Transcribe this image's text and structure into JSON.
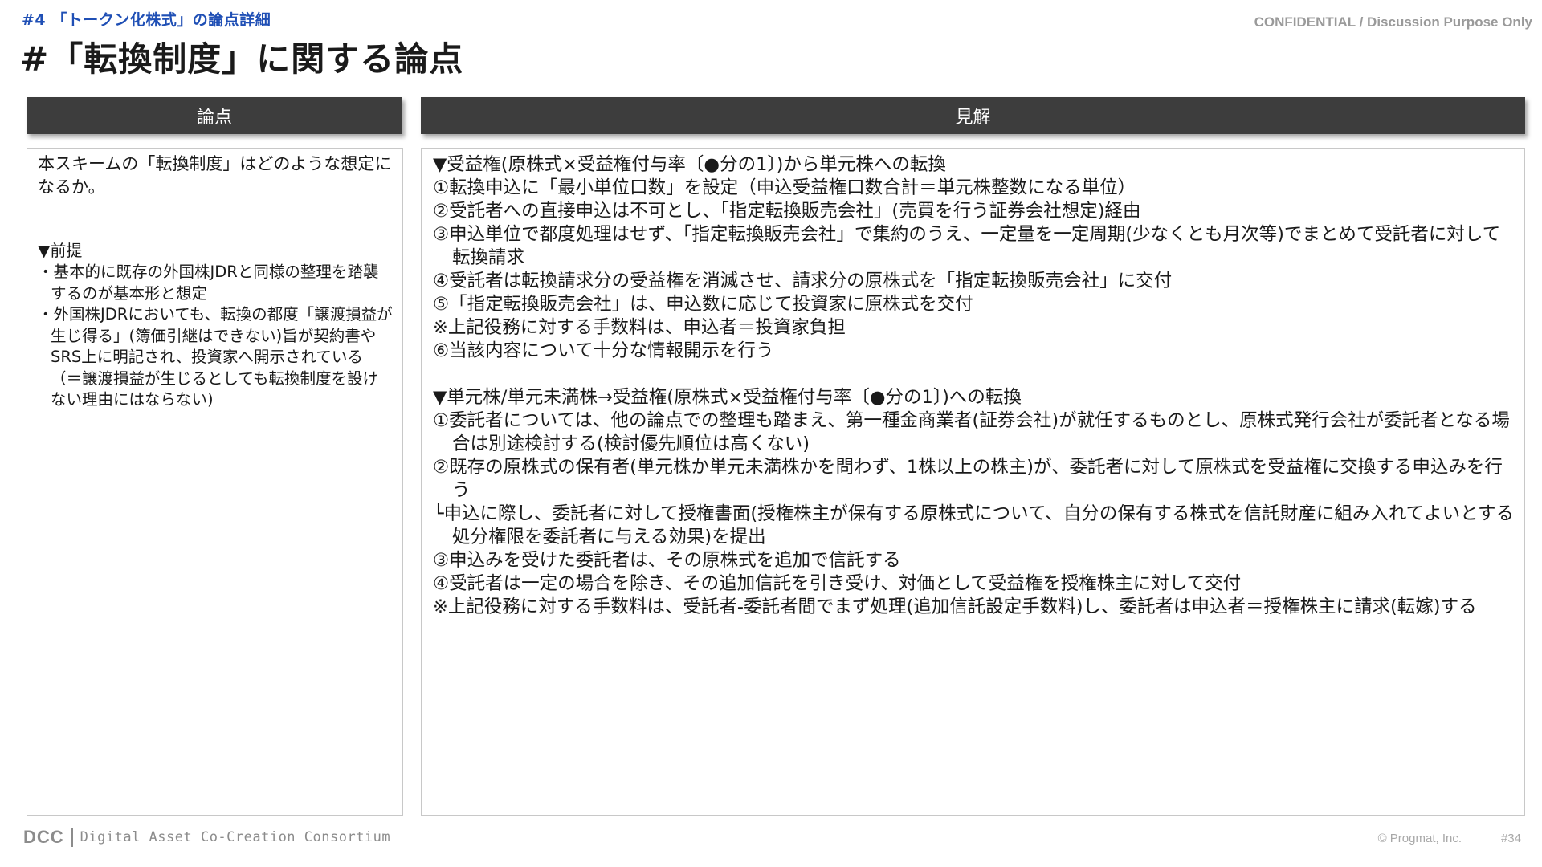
{
  "header": {
    "section_tag": "#4 「トークン化株式」の論点詳細",
    "confidential": "CONFIDENTIAL / Discussion Purpose Only",
    "title": "#「転換制度」に関する論点"
  },
  "columns": {
    "left_header": "論点",
    "right_header": "見解"
  },
  "left_panel": {
    "question": "本スキームの「転換制度」はどのような想定になるか。",
    "premise_heading": "▼前提",
    "premise_items": [
      "・基本的に既存の外国株JDRと同様の整理を踏襲するのが基本形と想定",
      "・外国株JDRにおいても、転換の都度「譲渡損益が生じ得る」(簿価引継はできない)旨が契約書やSRS上に明記され、投資家へ開示されている（＝譲渡損益が生じるとしても転換制度を設けない理由にはならない)"
    ]
  },
  "right_panel": {
    "section1_heading": "▼受益権(原株式×受益権付与率〔●分の1〕)から単元株への転換",
    "section1_items": [
      "①転換申込に「最小単位口数」を設定（申込受益権口数合計＝単元株整数になる単位）",
      "②受託者への直接申込は不可とし、「指定転換販売会社」(売買を行う証券会社想定)経由",
      "③申込単位で都度処理はせず、「指定転換販売会社」で集約のうえ、一定量を一定周期(少なくとも月次等)でまとめて受託者に対して転換請求",
      "④受託者は転換請求分の受益権を消滅させ、請求分の原株式を「指定転換販売会社」に交付",
      "⑤「指定転換販売会社」は、申込数に応じて投資家に原株式を交付",
      "※上記役務に対する手数料は、申込者＝投資家負担",
      "⑥当該内容について十分な情報開示を行う"
    ],
    "section2_heading": "▼単元株/単元未満株→受益権(原株式×受益権付与率〔●分の1〕)への転換",
    "section2_items": [
      "①委託者については、他の論点での整理も踏まえ、第一種金商業者(証券会社)が就任するものとし、原株式発行会社が委託者となる場合は別途検討する(検討優先順位は高くない)",
      "②既存の原株式の保有者(単元株か単元未満株かを問わず、1株以上の株主)が、委託者に対して原株式を受益権に交換する申込みを行う",
      "└申込に際し、委託者に対して授権書面(授権株主が保有する原株式について、自分の保有する株式を信託財産に組み入れてよいとする処分権限を委託者に与える効果)を提出",
      "③申込みを受けた委託者は、その原株式を追加で信託する",
      "④受託者は一定の場合を除き、その追加信託を引き受け、対価として受益権を授権株主に対して交付",
      "※上記役務に対する手数料は、受託者-委託者間でまず処理(追加信託設定手数料)し、委託者は申込者＝授権株主に請求(転嫁)する"
    ]
  },
  "footer": {
    "logo_text": "DCC",
    "org_name": "Digital Asset Co-Creation Consortium",
    "copyright": "©  Progmat, Inc.",
    "page_number": "#34"
  }
}
